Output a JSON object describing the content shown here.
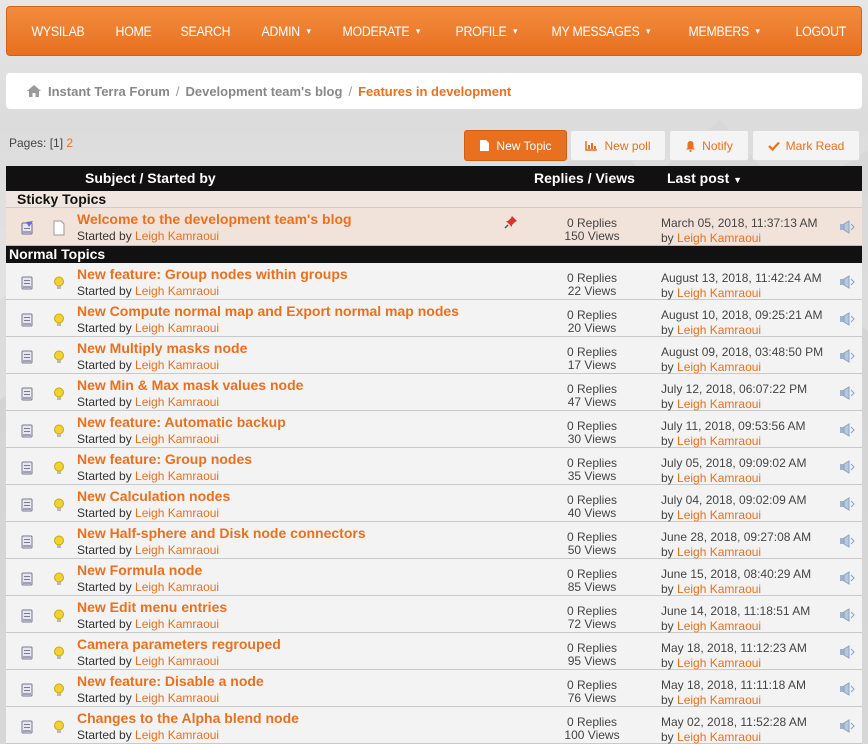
{
  "nav": [
    {
      "label": "WYSILAB",
      "caret": false
    },
    {
      "label": "HOME",
      "caret": false
    },
    {
      "label": "SEARCH",
      "caret": false
    },
    {
      "label": "ADMIN",
      "caret": true
    },
    {
      "label": "MODERATE",
      "caret": true
    },
    {
      "label": "PROFILE",
      "caret": true
    },
    {
      "label": "MY MESSAGES",
      "caret": true
    },
    {
      "label": "MEMBERS",
      "caret": true
    },
    {
      "label": "LOGOUT",
      "caret": false
    }
  ],
  "breadcrumb": {
    "items": [
      "Instant Terra Forum",
      "Development team's blog",
      "Features in development"
    ],
    "separator": "/"
  },
  "pages": {
    "label": "Pages:",
    "current": "[1]",
    "next": "2"
  },
  "buttons": {
    "new_topic": "New Topic",
    "new_poll": "New poll",
    "notify": "Notify",
    "mark_read": "Mark Read"
  },
  "table": {
    "col_subject": "Subject / Started by",
    "col_replies": "Replies / Views",
    "col_lastpost": "Last post",
    "sticky_title": "Sticky Topics",
    "normal_title": "Normal Topics",
    "started_by": "Started by",
    "by": "by"
  },
  "sticky_topics": [
    {
      "subject": "Welcome to the development team's blog",
      "author": "Leigh Kamraoui",
      "replies": "0 Replies",
      "views": "150 Views",
      "last_date": "March 05, 2018, 11:37:13 AM",
      "last_user": "Leigh Kamraoui"
    }
  ],
  "topics": [
    {
      "subject": "New feature: Group nodes within groups",
      "author": "Leigh Kamraoui",
      "replies": "0 Replies",
      "views": "22 Views",
      "last_date": "August 13, 2018, 11:42:24 AM",
      "last_user": "Leigh Kamraoui"
    },
    {
      "subject": "New Compute normal map and Export normal map nodes",
      "author": "Leigh Kamraoui",
      "replies": "0 Replies",
      "views": "20 Views",
      "last_date": "August 10, 2018, 09:25:21 AM",
      "last_user": "Leigh Kamraoui"
    },
    {
      "subject": "New Multiply masks node",
      "author": "Leigh Kamraoui",
      "replies": "0 Replies",
      "views": "17 Views",
      "last_date": "August 09, 2018, 03:48:50 PM",
      "last_user": "Leigh Kamraoui"
    },
    {
      "subject": "New Min & Max mask values node",
      "author": "Leigh Kamraoui",
      "replies": "0 Replies",
      "views": "47 Views",
      "last_date": "July 12, 2018, 06:07:22 PM",
      "last_user": "Leigh Kamraoui"
    },
    {
      "subject": "New feature: Automatic backup",
      "author": "Leigh Kamraoui",
      "replies": "0 Replies",
      "views": "30 Views",
      "last_date": "July 11, 2018, 09:53:56 AM",
      "last_user": "Leigh Kamraoui"
    },
    {
      "subject": "New feature: Group nodes",
      "author": "Leigh Kamraoui",
      "replies": "0 Replies",
      "views": "35 Views",
      "last_date": "July 05, 2018, 09:09:02 AM",
      "last_user": "Leigh Kamraoui"
    },
    {
      "subject": "New Calculation nodes",
      "author": "Leigh Kamraoui",
      "replies": "0 Replies",
      "views": "40 Views",
      "last_date": "July 04, 2018, 09:02:09 AM",
      "last_user": "Leigh Kamraoui"
    },
    {
      "subject": "New Half-sphere and Disk node connectors",
      "author": "Leigh Kamraoui",
      "replies": "0 Replies",
      "views": "50 Views",
      "last_date": "June 28, 2018, 09:27:08 AM",
      "last_user": "Leigh Kamraoui"
    },
    {
      "subject": "New Formula node",
      "author": "Leigh Kamraoui",
      "replies": "0 Replies",
      "views": "85 Views",
      "last_date": "June 15, 2018, 08:40:29 AM",
      "last_user": "Leigh Kamraoui"
    },
    {
      "subject": "New Edit menu entries",
      "author": "Leigh Kamraoui",
      "replies": "0 Replies",
      "views": "72 Views",
      "last_date": "June 14, 2018, 11:18:51 AM",
      "last_user": "Leigh Kamraoui"
    },
    {
      "subject": "Camera parameters regrouped",
      "author": "Leigh Kamraoui",
      "replies": "0 Replies",
      "views": "95 Views",
      "last_date": "May 18, 2018, 11:12:23 AM",
      "last_user": "Leigh Kamraoui"
    },
    {
      "subject": "New feature: Disable a node",
      "author": "Leigh Kamraoui",
      "replies": "0 Replies",
      "views": "76 Views",
      "last_date": "May 18, 2018, 11:11:18 AM",
      "last_user": "Leigh Kamraoui"
    },
    {
      "subject": "Changes to the Alpha blend node",
      "author": "Leigh Kamraoui",
      "replies": "0 Replies",
      "views": "100 Views",
      "last_date": "May 02, 2018, 11:52:28 AM",
      "last_user": "Leigh Kamraoui"
    }
  ],
  "colors": {
    "accent": "#e8701f",
    "header_bg": "#111111",
    "sticky_bg": "#f2e3da"
  }
}
